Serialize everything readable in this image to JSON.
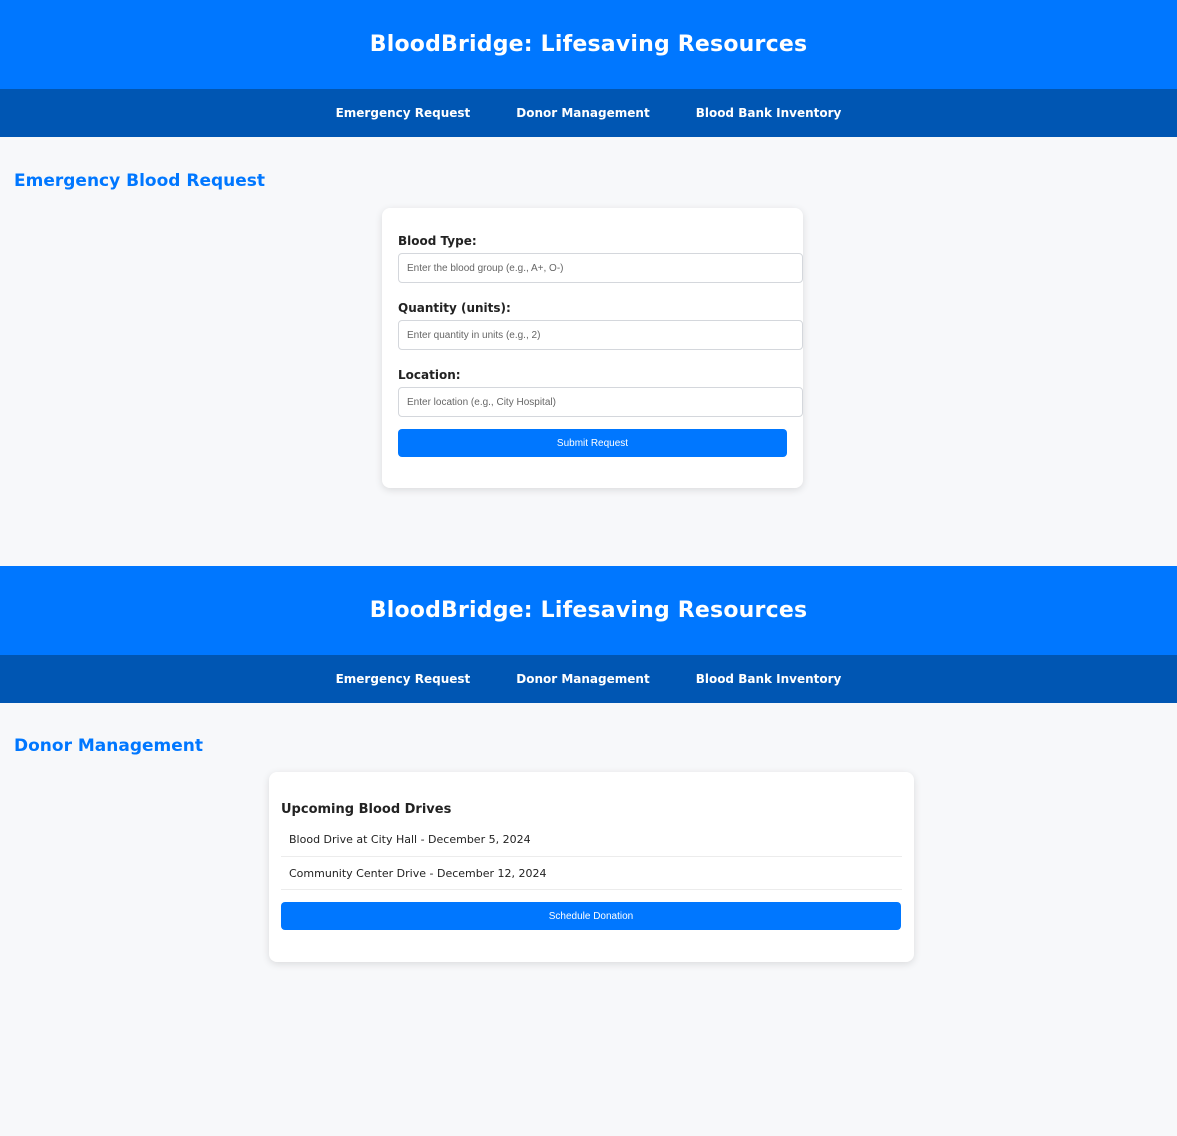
{
  "app": {
    "title": "BloodBridge: Lifesaving Resources"
  },
  "nav": {
    "items": [
      {
        "label": "Emergency Request"
      },
      {
        "label": "Donor Management"
      },
      {
        "label": "Blood Bank Inventory"
      }
    ]
  },
  "emergency": {
    "section_title": "Emergency Blood Request",
    "fields": [
      {
        "label": "Blood Type:",
        "placeholder": "Enter the blood group (e.g., A+, O-)",
        "value": ""
      },
      {
        "label": "Quantity (units):",
        "placeholder": "Enter quantity in units (e.g., 2)",
        "value": ""
      },
      {
        "label": "Location:",
        "placeholder": "Enter location (e.g., City Hospital)",
        "value": ""
      }
    ],
    "submit_label": "Submit Request"
  },
  "donor": {
    "section_title": "Donor Management",
    "drives_heading": "Upcoming Blood Drives",
    "drives": [
      {
        "text": "Blood Drive at City Hall - December 5, 2024"
      },
      {
        "text": "Community Center Drive - December 12, 2024"
      }
    ],
    "schedule_label": "Schedule Donation"
  },
  "colors": {
    "header": "#0077ff",
    "nav": "#0056b3",
    "accent": "#0077ff",
    "background": "#f7f8fa"
  }
}
